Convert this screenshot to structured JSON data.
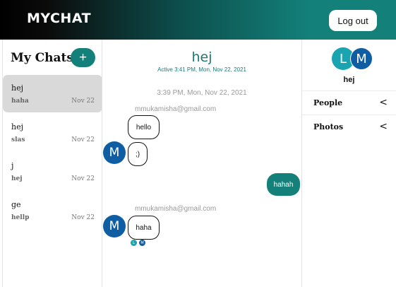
{
  "header": {
    "brand": "MYCHAT",
    "logout_label": "Log out"
  },
  "sidebar": {
    "title": "My Chats",
    "add_label": "+",
    "chats": [
      {
        "name": "hej",
        "last": "haha",
        "date": "Nov 22",
        "active": true
      },
      {
        "name": "hej",
        "last": "slas",
        "date": "Nov 22",
        "active": false
      },
      {
        "name": "j",
        "last": "hej",
        "date": "Nov 22",
        "active": false
      },
      {
        "name": "ge",
        "last": "hellp",
        "date": "Nov 22",
        "active": false
      }
    ]
  },
  "conversation": {
    "title": "hej",
    "subtitle": "Active 3:41 PM, Mon, Nov 22, 2021",
    "timestamp": "3:39 PM, Mon, Nov 22, 2021",
    "groups": [
      {
        "sender": "mmukamisha@gmail.com",
        "avatar_letter": "M",
        "messages": [
          "hello",
          ";)"
        ]
      },
      {
        "sender": "me",
        "messages": [
          "hahah"
        ]
      },
      {
        "sender": "mmukamisha@gmail.com",
        "avatar_letter": "M",
        "messages": [
          "haha"
        ]
      }
    ],
    "read_receipts": [
      "L",
      "M"
    ]
  },
  "details": {
    "avatars": [
      "L",
      "M"
    ],
    "name": "hej",
    "sections": [
      {
        "label": "People",
        "chevron": "<"
      },
      {
        "label": "Photos",
        "chevron": "<"
      }
    ]
  },
  "colors": {
    "accent": "#13807a",
    "avatar_m": "#0f5ea3",
    "avatar_l": "#1aa4b0",
    "active_chat": "#d9d9d9"
  }
}
